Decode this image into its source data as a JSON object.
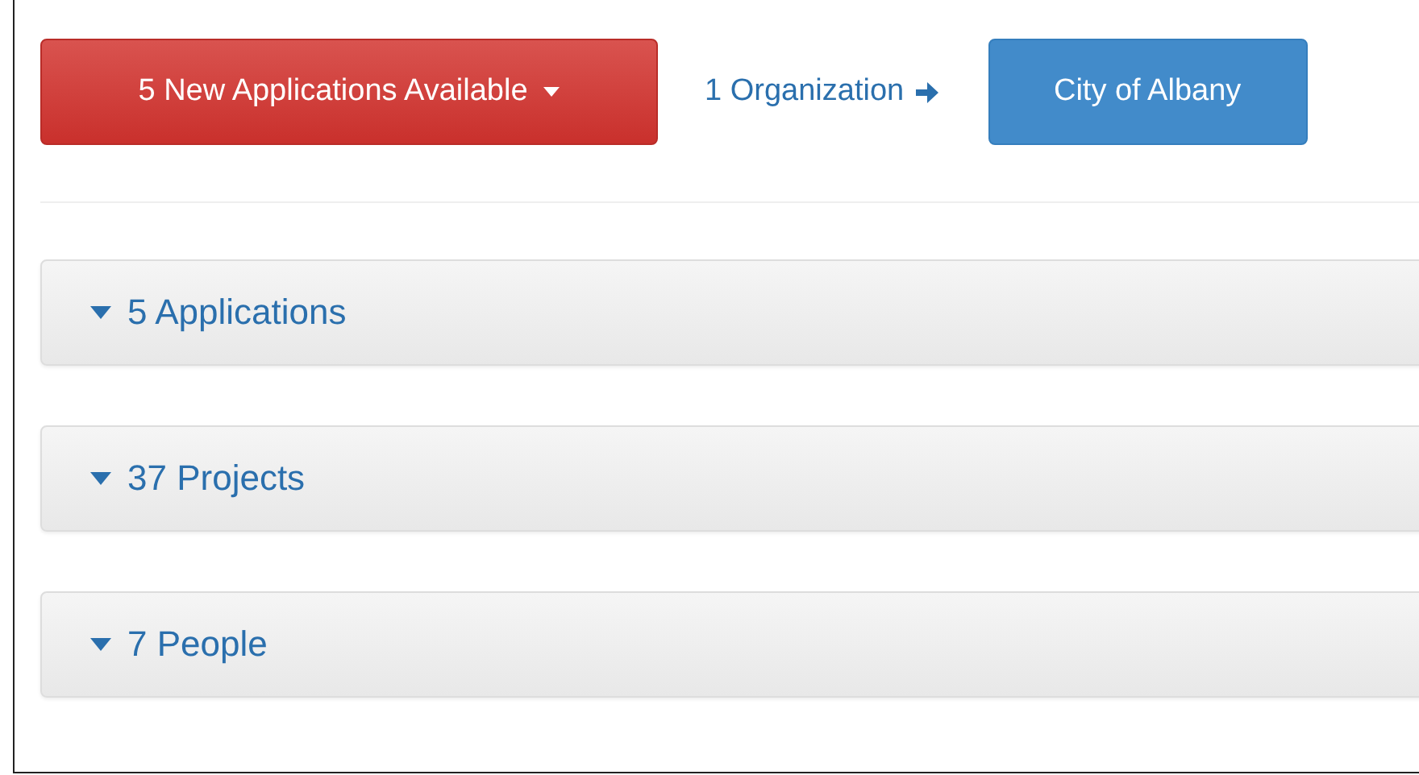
{
  "toolbar": {
    "applications_button": {
      "label": "5 New Applications Available"
    },
    "organization_link": {
      "label": "1 Organization"
    },
    "organization_button": {
      "label": "City of Albany"
    }
  },
  "panels": [
    {
      "title": "5 Applications"
    },
    {
      "title": "37 Projects"
    },
    {
      "title": "7 People"
    }
  ]
}
